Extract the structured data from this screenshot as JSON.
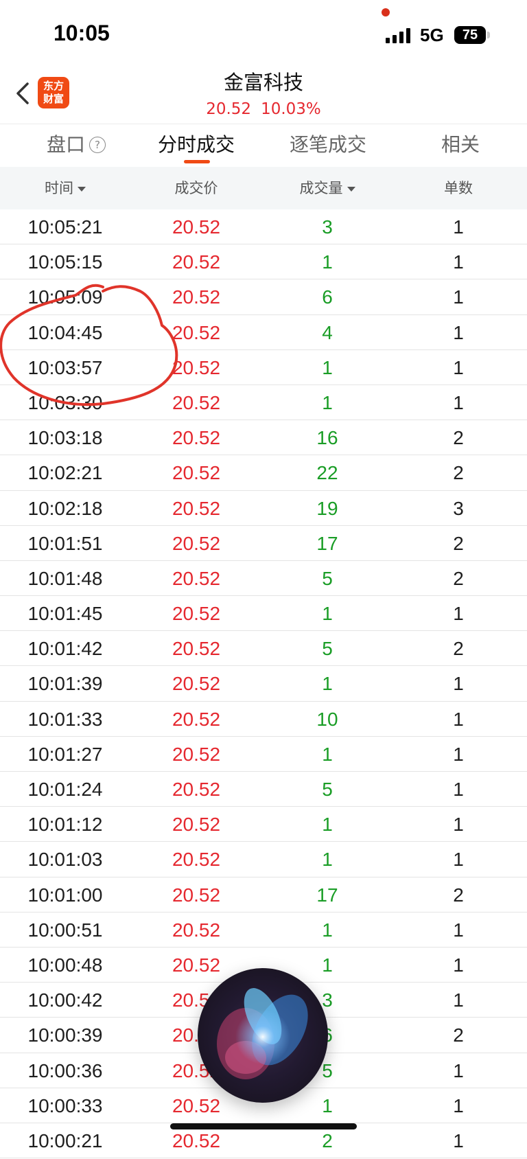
{
  "status_bar": {
    "time": "10:05",
    "network": "5G",
    "battery": "75"
  },
  "header": {
    "back_label": "<",
    "logo_text": "东方财富",
    "logo_line1": "东方",
    "logo_line2": "财富",
    "stock_name": "金富科技",
    "price": "20.52",
    "change_pct": "10.03%"
  },
  "tabs": [
    {
      "label": "盘口",
      "active": false
    },
    {
      "label": "分时成交",
      "active": true
    },
    {
      "label": "逐笔成交",
      "active": false
    },
    {
      "label": "相关",
      "active": false
    }
  ],
  "columns": {
    "time": "时间",
    "price": "成交价",
    "volume": "成交量",
    "count": "单数"
  },
  "trades": [
    {
      "time": "10:05:21",
      "price": "20.52",
      "volume": "3",
      "count": "1"
    },
    {
      "time": "10:05:15",
      "price": "20.52",
      "volume": "1",
      "count": "1"
    },
    {
      "time": "10:05:09",
      "price": "20.52",
      "volume": "6",
      "count": "1"
    },
    {
      "time": "10:04:45",
      "price": "20.52",
      "volume": "4",
      "count": "1"
    },
    {
      "time": "10:03:57",
      "price": "20.52",
      "volume": "1",
      "count": "1"
    },
    {
      "time": "10:03:30",
      "price": "20.52",
      "volume": "1",
      "count": "1"
    },
    {
      "time": "10:03:18",
      "price": "20.52",
      "volume": "16",
      "count": "2"
    },
    {
      "time": "10:02:21",
      "price": "20.52",
      "volume": "22",
      "count": "2"
    },
    {
      "time": "10:02:18",
      "price": "20.52",
      "volume": "19",
      "count": "3"
    },
    {
      "time": "10:01:51",
      "price": "20.52",
      "volume": "17",
      "count": "2"
    },
    {
      "time": "10:01:48",
      "price": "20.52",
      "volume": "5",
      "count": "2"
    },
    {
      "time": "10:01:45",
      "price": "20.52",
      "volume": "1",
      "count": "1"
    },
    {
      "time": "10:01:42",
      "price": "20.52",
      "volume": "5",
      "count": "2"
    },
    {
      "time": "10:01:39",
      "price": "20.52",
      "volume": "1",
      "count": "1"
    },
    {
      "time": "10:01:33",
      "price": "20.52",
      "volume": "10",
      "count": "1"
    },
    {
      "time": "10:01:27",
      "price": "20.52",
      "volume": "1",
      "count": "1"
    },
    {
      "time": "10:01:24",
      "price": "20.52",
      "volume": "5",
      "count": "1"
    },
    {
      "time": "10:01:12",
      "price": "20.52",
      "volume": "1",
      "count": "1"
    },
    {
      "time": "10:01:03",
      "price": "20.52",
      "volume": "1",
      "count": "1"
    },
    {
      "time": "10:01:00",
      "price": "20.52",
      "volume": "17",
      "count": "2"
    },
    {
      "time": "10:00:51",
      "price": "20.52",
      "volume": "1",
      "count": "1"
    },
    {
      "time": "10:00:48",
      "price": "20.52",
      "volume": "1",
      "count": "1"
    },
    {
      "time": "10:00:42",
      "price": "20.52",
      "volume": "3",
      "count": "1"
    },
    {
      "time": "10:00:39",
      "price": "20.52",
      "volume": "6",
      "count": "2"
    },
    {
      "time": "10:00:36",
      "price": "20.52",
      "volume": "5",
      "count": "1"
    },
    {
      "time": "10:00:33",
      "price": "20.52",
      "volume": "1",
      "count": "1"
    },
    {
      "time": "10:00:21",
      "price": "20.52",
      "volume": "2",
      "count": "1"
    }
  ],
  "overlays": {
    "annotation_color": "#e0342a",
    "siri_icon": "siri-orb-icon"
  },
  "colors": {
    "up_red": "#e5282f",
    "volume_green": "#1a9d26",
    "accent_orange": "#f04a14"
  }
}
